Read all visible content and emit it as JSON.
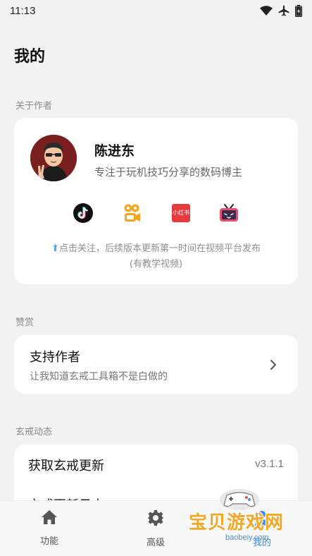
{
  "status_bar": {
    "time": "11:13",
    "icons": [
      "wifi-icon",
      "airplane-icon",
      "battery-charging-icon"
    ]
  },
  "page": {
    "title": "我的"
  },
  "about": {
    "section_label": "关于作者",
    "author_name": "陈进东",
    "author_desc": "专注于玩机技巧分享的数码博主",
    "socials": [
      {
        "name": "douyin-icon",
        "color": "#111111"
      },
      {
        "name": "kuaishou-icon",
        "color": "#f5a623"
      },
      {
        "name": "xiaohongshu-icon",
        "color": "#e83a3a"
      },
      {
        "name": "bilibili-tv-icon",
        "color": "#e94d6f"
      }
    ],
    "follow_note_line1": "点击关注，后续版本更新第一时间在视频平台发布",
    "follow_note_line2": "(有教学视频)",
    "follow_arrow": "⬆",
    "xiaohongshu_text": "小红书"
  },
  "support": {
    "section_label": "赞赏",
    "title": "支持作者",
    "subtitle": "让我知道玄戒工具箱不是白做的"
  },
  "updates": {
    "section_label": "玄戒动态",
    "rows": [
      {
        "label": "获取玄戒更新",
        "value": "v3.1.1"
      },
      {
        "label": "玄戒更新日志",
        "value": ""
      }
    ]
  },
  "nav": {
    "items": [
      {
        "label": "功能",
        "icon": "home-icon"
      },
      {
        "label": "高级",
        "icon": "gear-icon"
      },
      {
        "label": "我的",
        "icon": "person-icon"
      }
    ]
  },
  "watermark": {
    "text": "宝贝游戏网",
    "url": "baobeiy.com"
  },
  "colors": {
    "background": "#f2f2f2",
    "card": "#ffffff",
    "accent": "#2f8df0",
    "muted_text": "#8a8a8a"
  }
}
